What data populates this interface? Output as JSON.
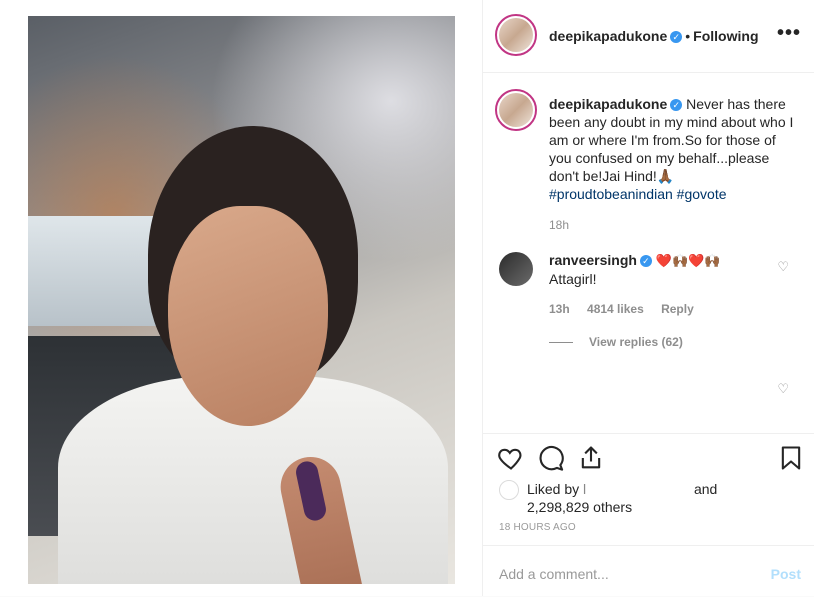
{
  "post": {
    "author": "deepikapadukone",
    "following_label": "Following",
    "more_label": "•••",
    "caption": "Never has there been any doubt in my mind about who I am or where I'm from.So for those of you confused on my behalf...please don't be!Jai Hind!🙏🏾",
    "hashtags": "#proudtobeanindian #govote",
    "caption_time": "18h"
  },
  "comment": {
    "author": "ranveersingh",
    "emojis": "❤️🙌🏾❤️🙌🏾",
    "text": "Attagirl!",
    "time": "13h",
    "likes": "4814 likes",
    "reply_label": "Reply",
    "view_replies": "View replies (62)"
  },
  "likes": {
    "prefix": "Liked by",
    "redacted": "l",
    "and": "and",
    "count": "2,298,829 others"
  },
  "posted_time": "18 HOURS AGO",
  "comment_box": {
    "placeholder": "Add a comment...",
    "post_label": "Post"
  },
  "colors": {
    "verified": "#3897f0",
    "post_button_disabled": "#b2dffc",
    "hashtag": "#003569"
  }
}
